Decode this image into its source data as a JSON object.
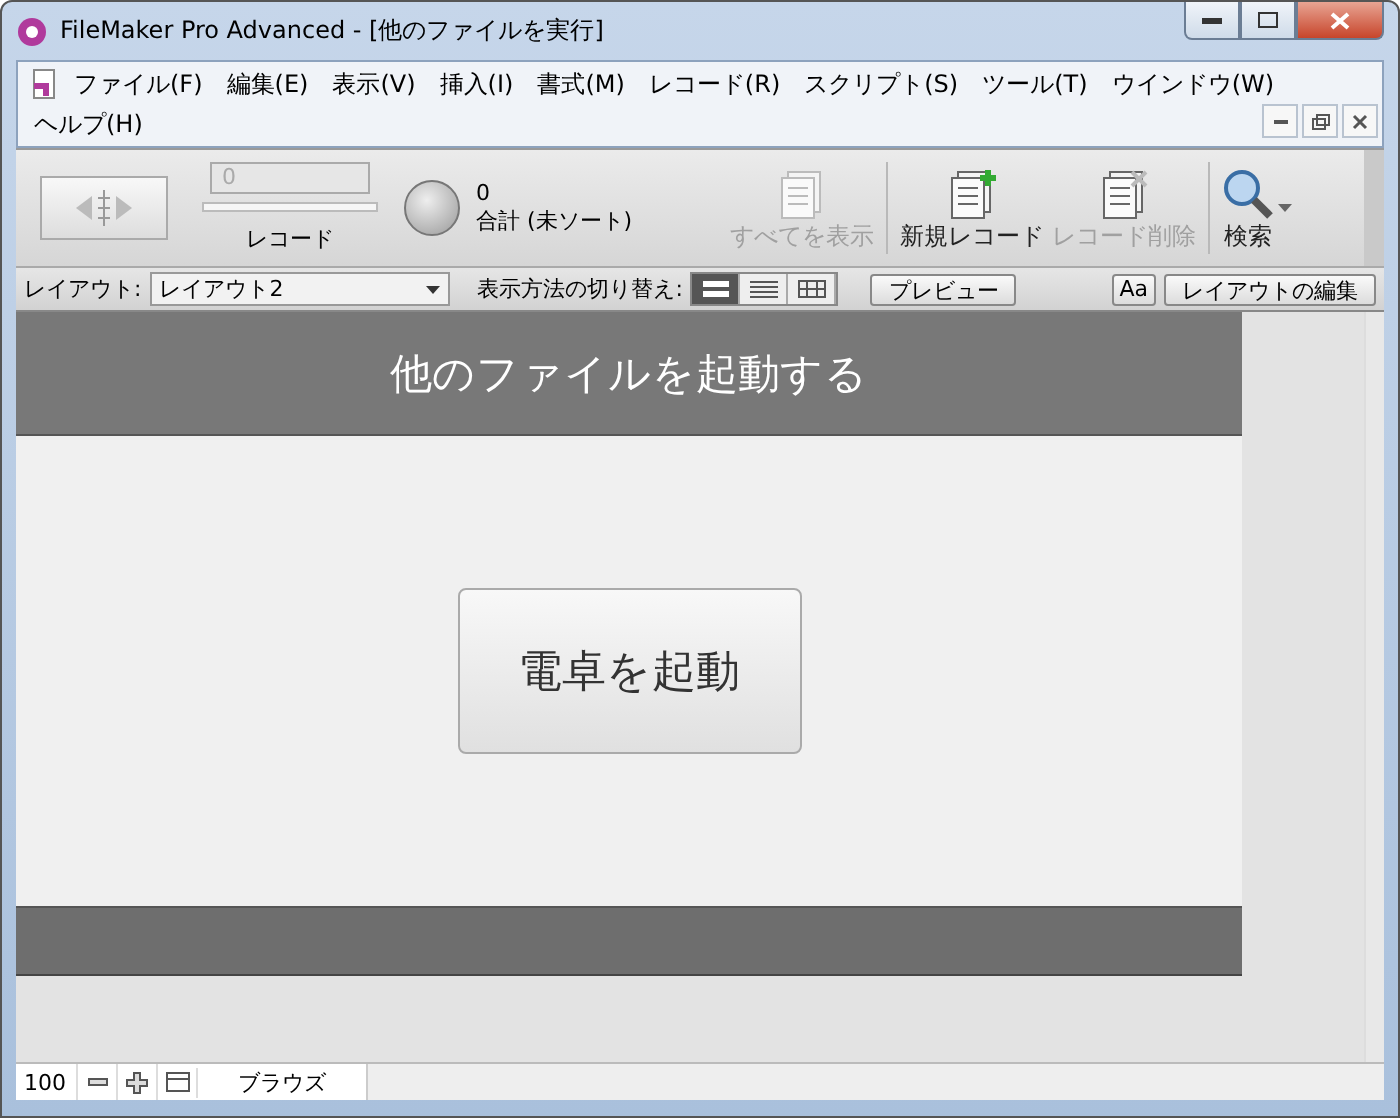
{
  "window": {
    "title": "FileMaker Pro Advanced - [他のファイルを実行]"
  },
  "menu": [
    "ファイル(F)",
    "編集(E)",
    "表示(V)",
    "挿入(I)",
    "書式(M)",
    "レコード(R)",
    "スクリプト(S)",
    "ツール(T)",
    "ウインドウ(W)",
    "ヘルプ(H)"
  ],
  "toolbar": {
    "record_field": "0",
    "record_label": "レコード",
    "found": "0",
    "total": "合計 (未ソート)",
    "buttons": [
      {
        "kind": "show-all",
        "label": "すべてを表示",
        "disabled": true
      },
      {
        "kind": "new",
        "label": "新規レコード",
        "disabled": false
      },
      {
        "kind": "delete",
        "label": "レコード削除",
        "disabled": true
      },
      {
        "kind": "find",
        "label": "検索",
        "disabled": false
      }
    ]
  },
  "layout_bar": {
    "layout_label": "レイアウト:",
    "layout_value": "レイアウト2",
    "view_label": "表示方法の切り替え:",
    "views": [
      {
        "kind": "form",
        "selected": true
      },
      {
        "kind": "list",
        "selected": false
      },
      {
        "kind": "table",
        "selected": false
      }
    ],
    "preview": "プレビュー",
    "font_button": "Aa",
    "edit_layout": "レイアウトの編集"
  },
  "content": {
    "header": "他のファイルを起動する",
    "button": "電卓を起動"
  },
  "status_bar": {
    "zoom": "100",
    "mode": "ブラウズ"
  }
}
